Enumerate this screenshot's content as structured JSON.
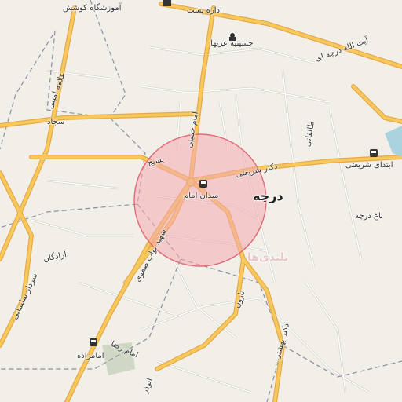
{
  "map": {
    "colors": {
      "land": "#f2efe9",
      "major_road": "#f7c95b",
      "major_road_casing": "#e6a84a",
      "minor_road": "#ffffff",
      "minor_road_casing": "#c9c4bc",
      "admin_boundary": "#8a8fa0",
      "highlight_fill": "#f4a9b0",
      "highlight_stroke": "#e06a78",
      "park": "#cfd8c4",
      "poi_icon": "#333333",
      "water": "#aad3df"
    },
    "places": {
      "main": "درچه",
      "district": "بلندی‌ها"
    },
    "roads": {
      "ayatollah_dorcheie": "آیت الله درچه ای",
      "imam_khomeini": "امام خمینی",
      "dr_shariati": "دکتر شریعتی",
      "sajjad": "سجاد",
      "allameh_amini": "علامه امینی",
      "basij": "بسیج",
      "shahid_navab_safavi": "شهید نواب صفوی",
      "azadegan": "آزادگان",
      "sardar_soleimani": "سردار سلیمانی",
      "imam_reza": "امام رضا",
      "taleghani": "طالقانی",
      "narges": "نارون",
      "dr_bahonar": "دکتر بهشتی",
      "abuzar": "ابوذر"
    },
    "pois": {
      "post_office": "اداره پست",
      "hoseinieh": "حسینیه عربها",
      "amoozeshgah": "آموزشگاه کوشش",
      "meydan_imam": "میدان امام",
      "ebteday_shariati": "ابتدای شریعتی",
      "bagh_dorche": "باغ درچه",
      "imamzadeh": "امامزاده"
    },
    "icons": [
      "bus-stop-icon",
      "mosque-icon",
      "roundabout-icon"
    ]
  }
}
